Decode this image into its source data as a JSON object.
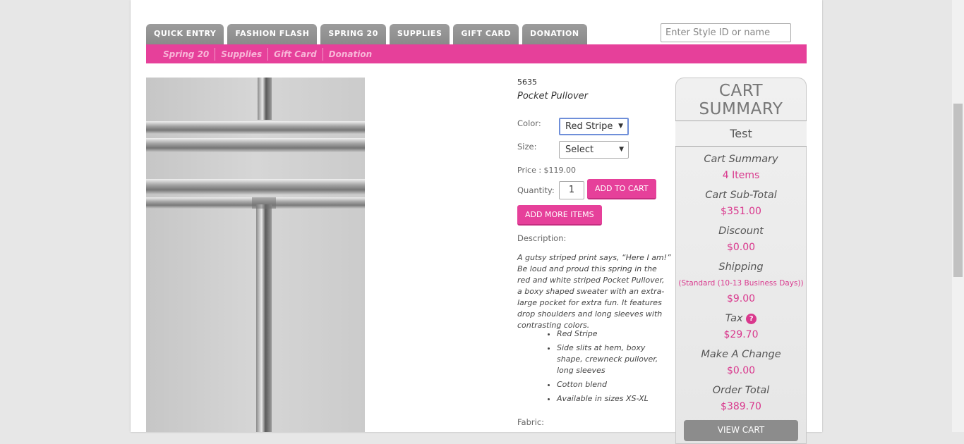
{
  "tabs": [
    "QUICK ENTRY",
    "FASHION FLASH",
    "SPRING 20",
    "SUPPLIES",
    "GIFT CARD",
    "DONATION"
  ],
  "search": {
    "placeholder": "Enter Style ID or name"
  },
  "subnav": [
    "Spring 20",
    "Supplies",
    "Gift Card",
    "Donation"
  ],
  "product": {
    "style_id": "5635",
    "name": "Pocket Pullover",
    "color_label": "Color:",
    "color_value": "Red Stripe",
    "size_label": "Size:",
    "size_value": "Select",
    "price": "Price : $119.00",
    "quantity_label": "Quantity:",
    "quantity_value": "1",
    "add_to_cart": "ADD TO CART",
    "add_more": "ADD MORE ITEMS",
    "description_label": "Description:",
    "description": "A gutsy striped print says, “Here I am!” Be loud and proud this spring in the red and white striped Pocket Pullover, a boxy shaped sweater with an extra-large pocket for extra fun. It features drop shoulders and long sleeves with contrasting colors.",
    "bullets": [
      "Red Stripe",
      "Side slits at hem, boxy shape, crewneck pullover, long sleeves",
      "Cotton blend",
      "Available in sizes XS-XL"
    ],
    "fabric_label": "Fabric:"
  },
  "cart": {
    "title": "CART SUMMARY",
    "user": "Test",
    "summary_label": "Cart Summary",
    "items": "4 Items",
    "subtotal_label": "Cart Sub-Total",
    "subtotal": "$351.00",
    "discount_label": "Discount",
    "discount": "$0.00",
    "shipping_label": "Shipping",
    "shipping_method": "(Standard (10-13 Business Days))",
    "shipping": "$9.00",
    "tax_label": "Tax",
    "tax": "$29.70",
    "change_label": "Make A Change",
    "change": "$0.00",
    "total_label": "Order Total",
    "total": "$389.70",
    "view_cart": "VIEW CART"
  },
  "icons": {
    "help": "question-icon",
    "dropdown": "chevron-down-icon"
  },
  "colors": {
    "accent": "#e6409a",
    "tab": "#8f8f8f"
  }
}
